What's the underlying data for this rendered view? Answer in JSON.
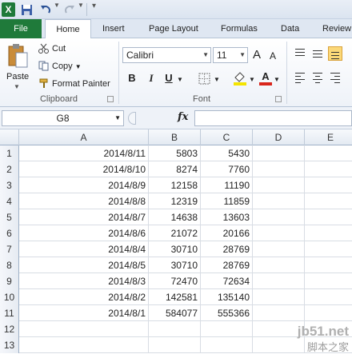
{
  "qat": {
    "logo": "X"
  },
  "tabs": [
    "File",
    "Home",
    "Insert",
    "Page Layout",
    "Formulas",
    "Data",
    "Review"
  ],
  "clipboard": {
    "paste": "Paste",
    "cut": "Cut",
    "copy": "Copy",
    "format_painter": "Format Painter",
    "label": "Clipboard"
  },
  "font": {
    "name": "Calibri",
    "size": "11",
    "label": "Font",
    "grow": "A",
    "shrink": "A",
    "bold": "B",
    "italic": "I",
    "underline": "U",
    "font_color": "A"
  },
  "formula_bar": {
    "name_box": "G8",
    "fx": "fx",
    "value": ""
  },
  "sheet": {
    "columns": [
      "A",
      "B",
      "C",
      "D",
      "E"
    ],
    "rows": [
      {
        "n": "1",
        "a": "2014/8/11",
        "b": "5803",
        "c": "5430"
      },
      {
        "n": "2",
        "a": "2014/8/10",
        "b": "8274",
        "c": "7760"
      },
      {
        "n": "3",
        "a": "2014/8/9",
        "b": "12158",
        "c": "11190"
      },
      {
        "n": "4",
        "a": "2014/8/8",
        "b": "12319",
        "c": "11859"
      },
      {
        "n": "5",
        "a": "2014/8/7",
        "b": "14638",
        "c": "13603"
      },
      {
        "n": "6",
        "a": "2014/8/6",
        "b": "21072",
        "c": "20166"
      },
      {
        "n": "7",
        "a": "2014/8/4",
        "b": "30710",
        "c": "28769"
      },
      {
        "n": "8",
        "a": "2014/8/5",
        "b": "30710",
        "c": "28769"
      },
      {
        "n": "9",
        "a": "2014/8/3",
        "b": "72470",
        "c": "72634"
      },
      {
        "n": "10",
        "a": "2014/8/2",
        "b": "142581",
        "c": "135140"
      },
      {
        "n": "11",
        "a": "2014/8/1",
        "b": "584077",
        "c": "555366"
      },
      {
        "n": "12",
        "a": "",
        "b": "",
        "c": ""
      },
      {
        "n": "13",
        "a": "",
        "b": "",
        "c": ""
      }
    ]
  },
  "watermark": {
    "line1": "jb51.net",
    "line2": "脚本之家"
  }
}
